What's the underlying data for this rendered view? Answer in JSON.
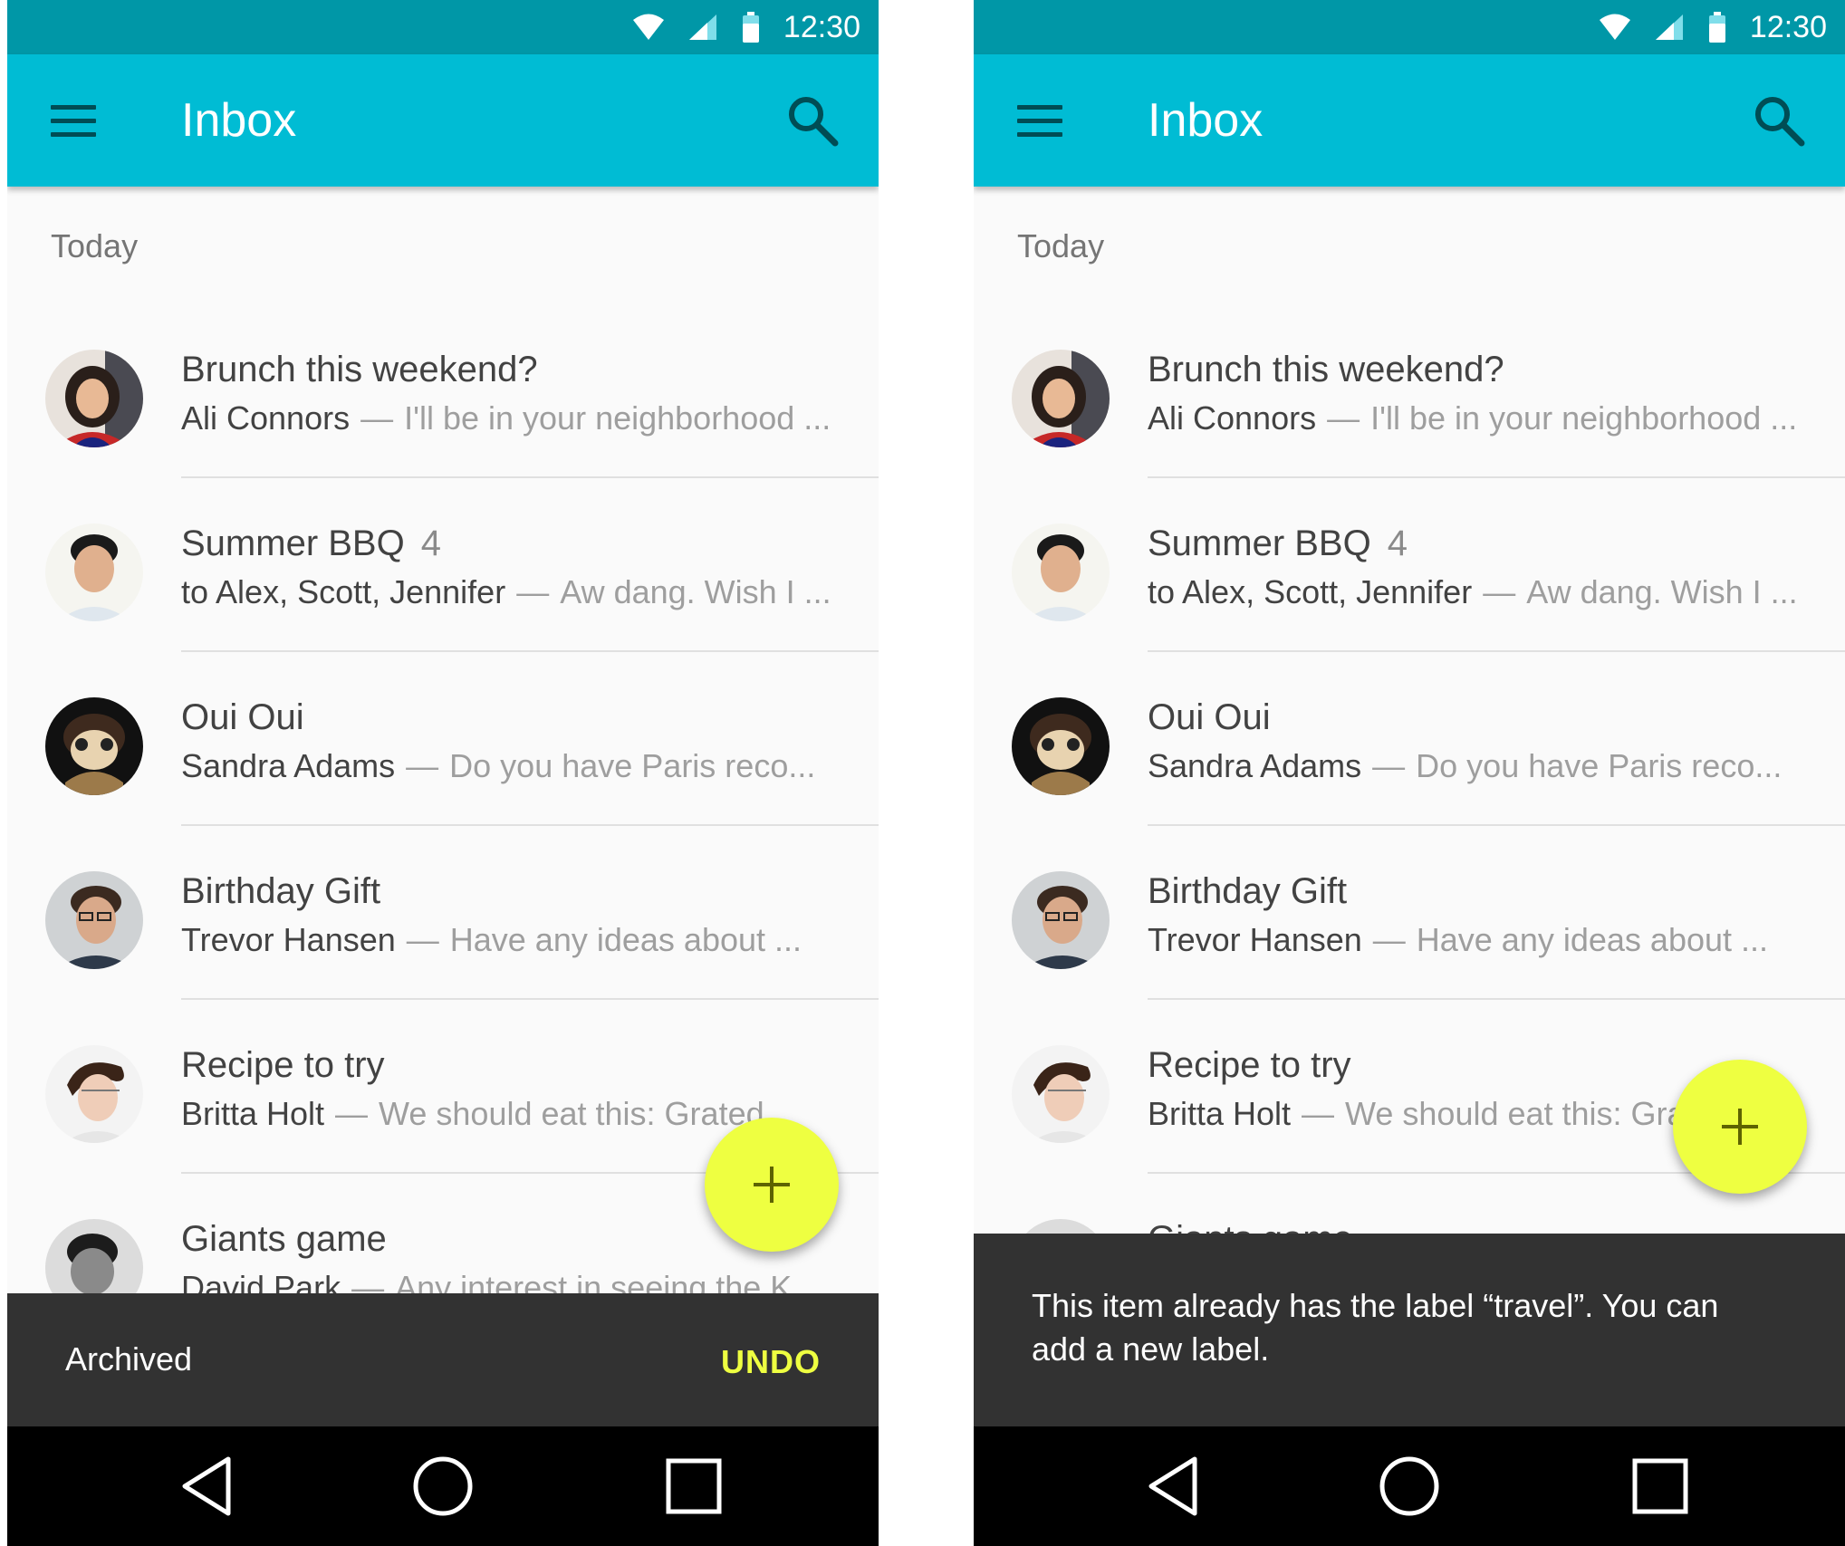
{
  "status_bar": {
    "time": "12:30",
    "icons": [
      "wifi-icon",
      "cell-signal-icon",
      "battery-icon"
    ]
  },
  "app_bar": {
    "title": "Inbox",
    "menu_icon": "menu-icon",
    "search_icon": "search-icon"
  },
  "section": {
    "label": "Today"
  },
  "emails": [
    {
      "subject": "Brunch this weekend?",
      "count": "",
      "sender": "Ali Connors",
      "dash": "—",
      "snippet": "I'll be in your neighborhood ..."
    },
    {
      "subject": "Summer BBQ",
      "count": "4",
      "sender": "to Alex, Scott, Jennifer",
      "dash": "—",
      "snippet": "Aw dang. Wish I ..."
    },
    {
      "subject": "Oui Oui",
      "count": "",
      "sender": "Sandra Adams",
      "dash": "—",
      "snippet": "Do you have Paris reco..."
    },
    {
      "subject": "Birthday Gift",
      "count": "",
      "sender": "Trevor Hansen",
      "dash": "—",
      "snippet": "Have any ideas about ..."
    },
    {
      "subject": "Recipe to try",
      "count": "",
      "sender": "Britta Holt",
      "dash": "—",
      "snippet": "We should eat this: Grated"
    },
    {
      "subject": "Giants game",
      "count": "",
      "sender": "David Park",
      "dash": "—",
      "snippet": "Any interest in seeing the K..."
    }
  ],
  "snackbar_left": {
    "message": "Archived",
    "action": "UNDO"
  },
  "snackbar_right": {
    "message": "This item already has the label “travel”. You can add a new label."
  },
  "fab": {
    "icon": "plus-icon"
  },
  "nav_bar": {
    "icons": [
      "back-icon",
      "home-icon",
      "recents-icon"
    ]
  },
  "colors": {
    "status_bar": "#0097a7",
    "app_bar": "#00bcd4",
    "fab": "#eeff41",
    "snackbar": "#323232",
    "undo": "#eeff41",
    "background": "#fafafa"
  }
}
